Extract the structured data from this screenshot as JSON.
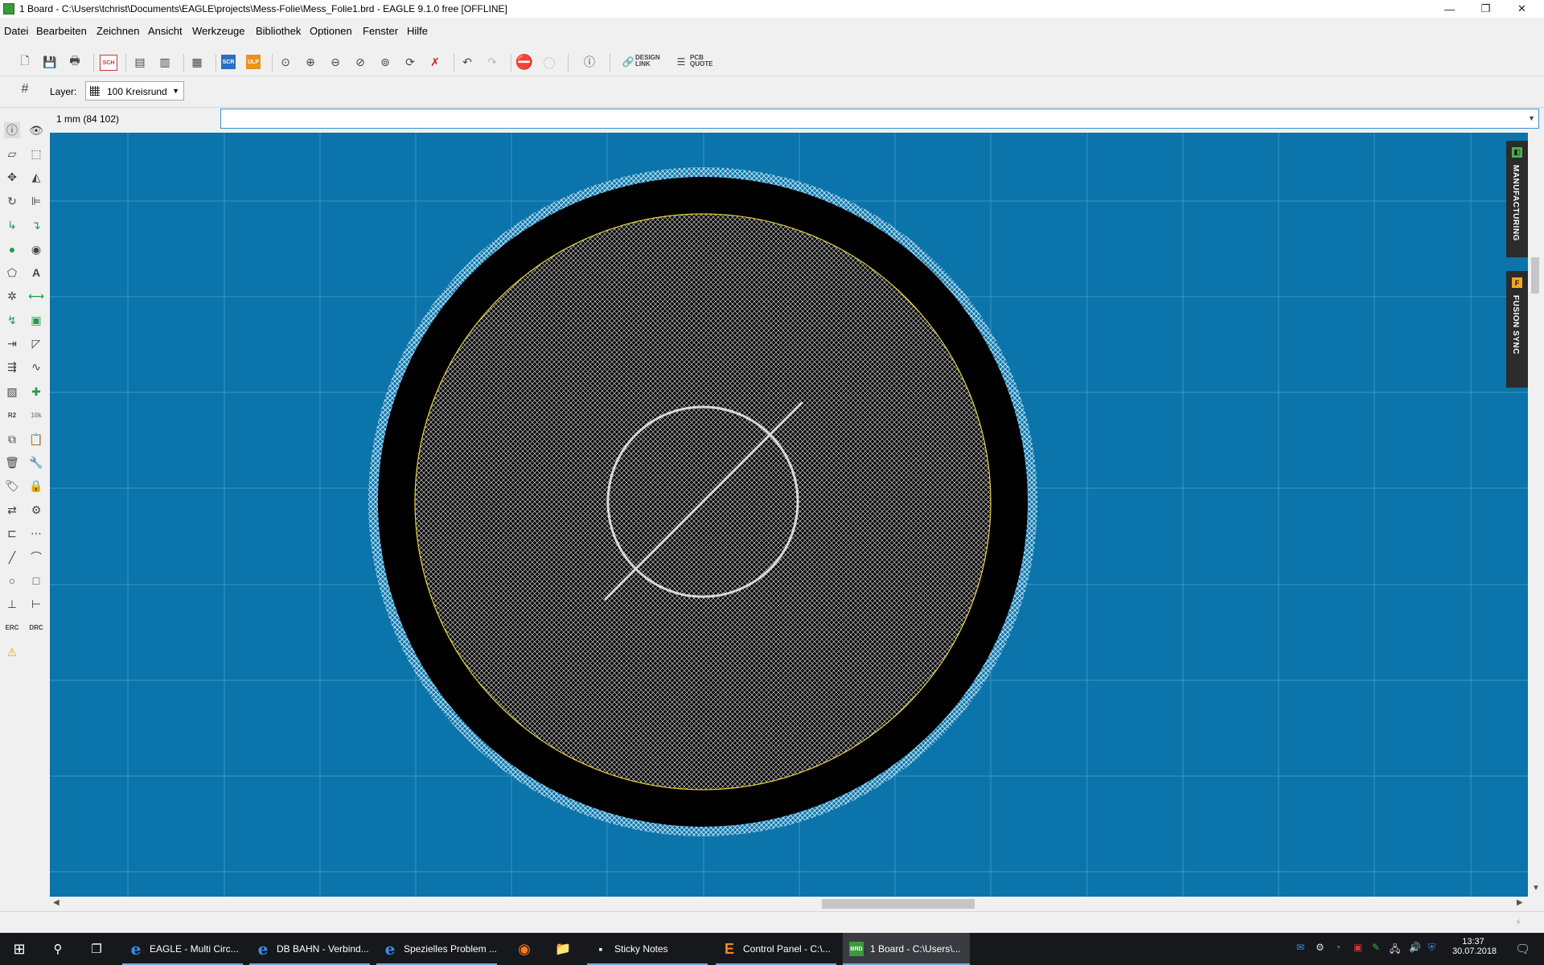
{
  "window": {
    "title": "1 Board - C:\\Users\\tchrist\\Documents\\EAGLE\\projects\\Mess-Folie\\Mess_Folie1.brd - EAGLE 9.1.0 free [OFFLINE]",
    "minimize": "—",
    "restore": "❐",
    "close": "✕"
  },
  "menu": [
    "Datei",
    "Bearbeiten",
    "Zeichnen",
    "Ansicht",
    "Werkzeuge",
    "Bibliothek",
    "Optionen",
    "Fenster",
    "Hilfe"
  ],
  "toolbar": {
    "sch": "SCH",
    "scr": "SCR",
    "ulp": "ULP",
    "design_link_1": "DESIGN",
    "design_link_2": "LINK",
    "pcb_quote_1": "PCB",
    "pcb_quote_2": "QUOTE"
  },
  "layerbar": {
    "label": "Layer:",
    "selected": "100 Kreisrund"
  },
  "coordinate_readout": "1 mm (84 102)",
  "command_line": {
    "value": ""
  },
  "left_tools": {
    "r2": "R2",
    "r2_10k": "10k",
    "erc": "ERC",
    "drc": "DRC"
  },
  "side_panels": [
    {
      "label": "MANUFACTURING",
      "badge": "◧",
      "badge_color": "#4caf50"
    },
    {
      "label": "FUSION SYNC",
      "badge": "F",
      "badge_color": "#f5a623"
    }
  ],
  "colors": {
    "canvas": "#0b74aa",
    "board_ring": "#000000",
    "outline": "#e6d23c",
    "hatch": "#9fd0ea"
  },
  "taskbar": {
    "items": [
      {
        "label": "EAGLE - Multi Circ...",
        "icon": "e"
      },
      {
        "label": "DB BAHN - Verbind...",
        "icon": "e"
      },
      {
        "label": "Spezielles Problem ...",
        "icon": "e"
      },
      {
        "label": "Sticky Notes",
        "icon": "▪"
      },
      {
        "label": "Control Panel - C:\\...",
        "icon": "E"
      },
      {
        "label": "1 Board - C:\\Users\\...",
        "icon": "BRD"
      }
    ],
    "time": "13:37",
    "date": "30.07.2018"
  }
}
